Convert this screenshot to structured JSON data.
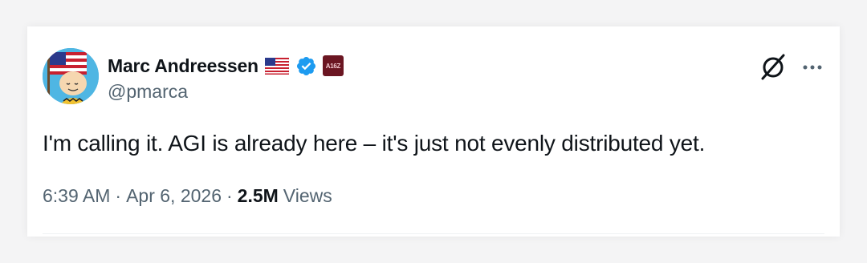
{
  "tweet": {
    "author": {
      "display_name": "Marc Andreessen",
      "handle": "@pmarca",
      "flag_icon": "us-flag-icon",
      "verified_icon": "verified-badge-icon",
      "verified_color": "#1d9bf0",
      "affiliate_badge_text": "A16Z",
      "affiliate_badge_color": "#6b1622"
    },
    "text": "I'm calling it. AGI is already here – it's just not evenly distributed yet.",
    "time": "6:39 AM",
    "date": "Apr 6, 2026",
    "separator": "·",
    "views_count": "2.5M",
    "views_label": "Views",
    "actions": {
      "grok_icon": "grok-icon",
      "more_icon": "more-options-icon"
    }
  }
}
